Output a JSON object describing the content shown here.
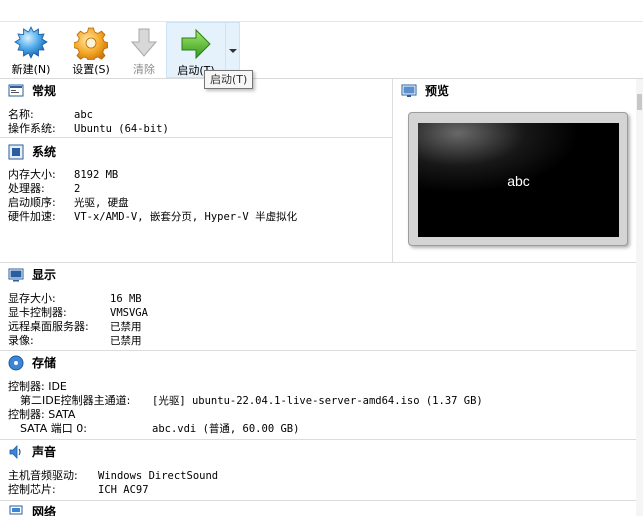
{
  "toolbar": {
    "new_label": "新建(N)",
    "settings_label": "设置(S)",
    "discard_label": "清除",
    "start_label": "启动(T)"
  },
  "tooltip": "启动(T)",
  "general": {
    "title": "常规",
    "rows": [
      {
        "key": "名称:",
        "value": "abc"
      },
      {
        "key": "操作系统:",
        "value": "Ubuntu (64-bit)"
      }
    ]
  },
  "system": {
    "title": "系统",
    "rows": [
      {
        "key": "内存大小:",
        "value": "8192 MB"
      },
      {
        "key": "处理器:",
        "value": "2"
      },
      {
        "key": "启动顺序:",
        "value": "光驱, 硬盘"
      },
      {
        "key": "硬件加速:",
        "value": "VT-x/AMD-V, 嵌套分页, Hyper-V 半虚拟化"
      }
    ]
  },
  "preview": {
    "title": "预览",
    "vm_name": "abc"
  },
  "display": {
    "title": "显示",
    "rows": [
      {
        "key": "显存大小:",
        "value": "16 MB"
      },
      {
        "key": "显卡控制器:",
        "value": "VMSVGA"
      },
      {
        "key": "远程桌面服务器:",
        "value": "已禁用"
      },
      {
        "key": "录像:",
        "value": "已禁用"
      }
    ]
  },
  "storage": {
    "title": "存储",
    "rows": [
      {
        "key": "控制器: IDE",
        "value": ""
      },
      {
        "key": "  第二IDE控制器主通道:",
        "value": "[光驱] ubuntu-22.04.1-live-server-amd64.iso (1.37 GB)"
      },
      {
        "key": "控制器: SATA",
        "value": ""
      },
      {
        "key": "  SATA 端口 0:",
        "value": "abc.vdi (普通, 60.00 GB)"
      }
    ]
  },
  "audio": {
    "title": "声音",
    "rows": [
      {
        "key": "主机音频驱动:",
        "value": "Windows DirectSound"
      },
      {
        "key": "控制芯片:",
        "value": "ICH AC97"
      }
    ]
  },
  "network": {
    "title": "网络"
  },
  "colors": {
    "accent_green": "#3fae29",
    "accent_blue": "#1e6fbf",
    "active_bg": "#e5f1fb"
  }
}
